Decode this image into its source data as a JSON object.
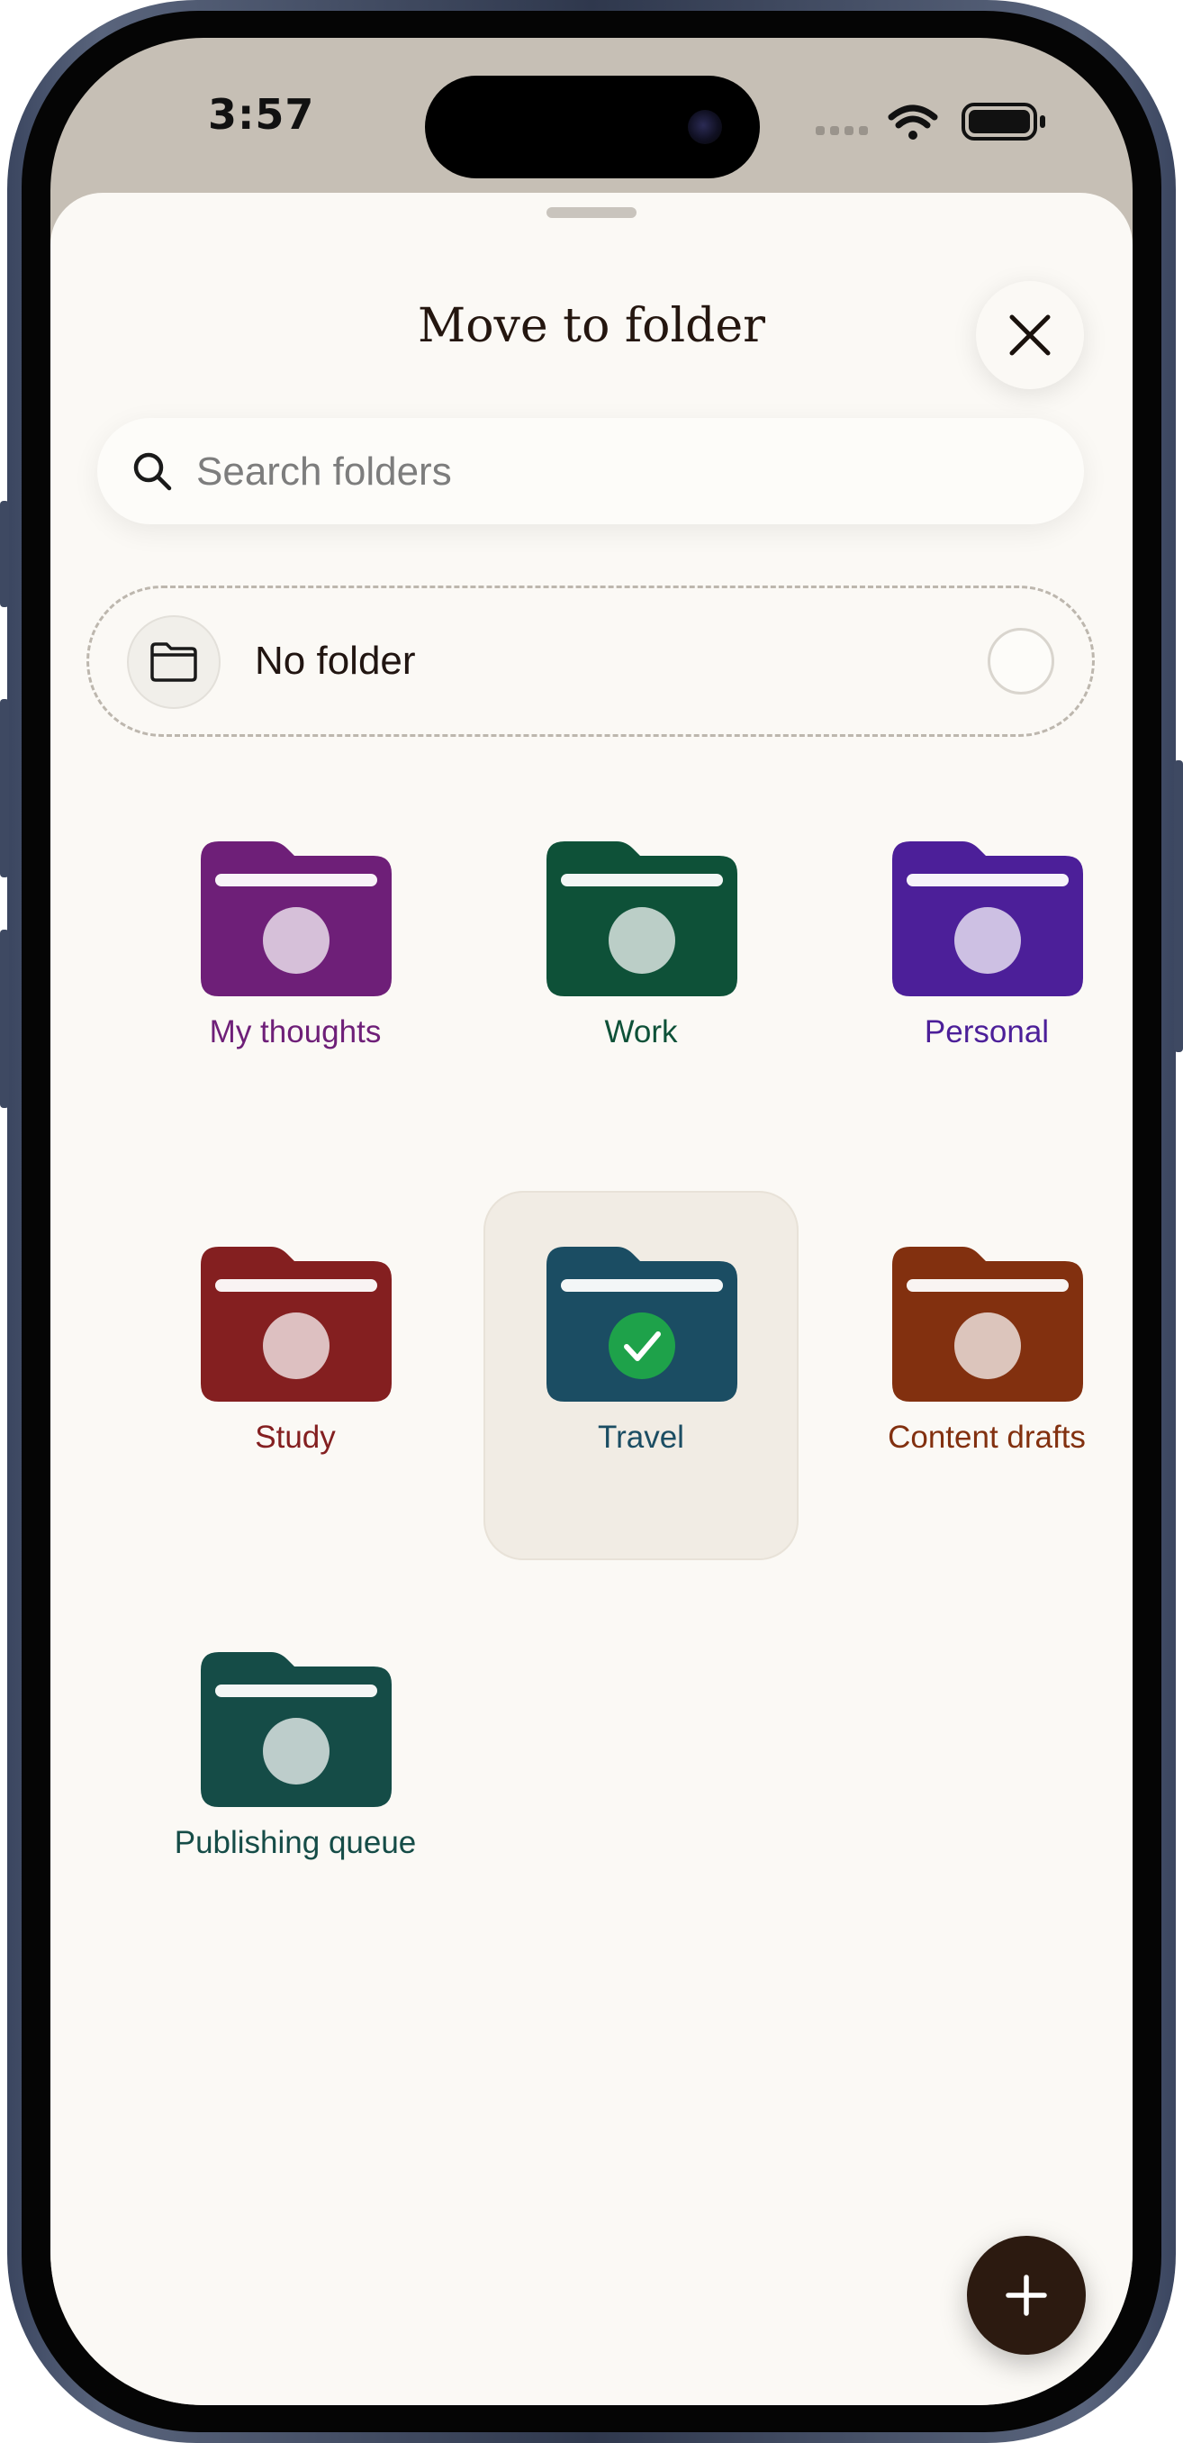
{
  "status_bar": {
    "time": "3:57"
  },
  "sheet": {
    "title": "Move to folder",
    "search_placeholder": "Search folders",
    "no_folder_label": "No folder"
  },
  "folders": [
    {
      "name": "My thoughts",
      "color": "#6e1f78",
      "selected": false
    },
    {
      "name": "Work",
      "color": "#0e5138",
      "selected": false
    },
    {
      "name": "Personal",
      "color": "#4c1f99",
      "selected": false
    },
    {
      "name": "Study",
      "color": "#841f20",
      "selected": false
    },
    {
      "name": "Travel",
      "color": "#1b4d63",
      "selected": true
    },
    {
      "name": "Content drafts",
      "color": "#82300f",
      "selected": false
    },
    {
      "name": "Publishing queue",
      "color": "#154c47",
      "selected": false
    }
  ],
  "colors": {
    "sheet_bg": "#fbf9f5",
    "title": "#24160f",
    "selected_check": "#1ea24a",
    "fab_bg": "#2c1a10"
  },
  "icons": {
    "close": "close-icon",
    "search": "search-icon",
    "no_folder": "folder-outline-icon",
    "add": "plus-icon",
    "selected": "checkmark-icon"
  }
}
